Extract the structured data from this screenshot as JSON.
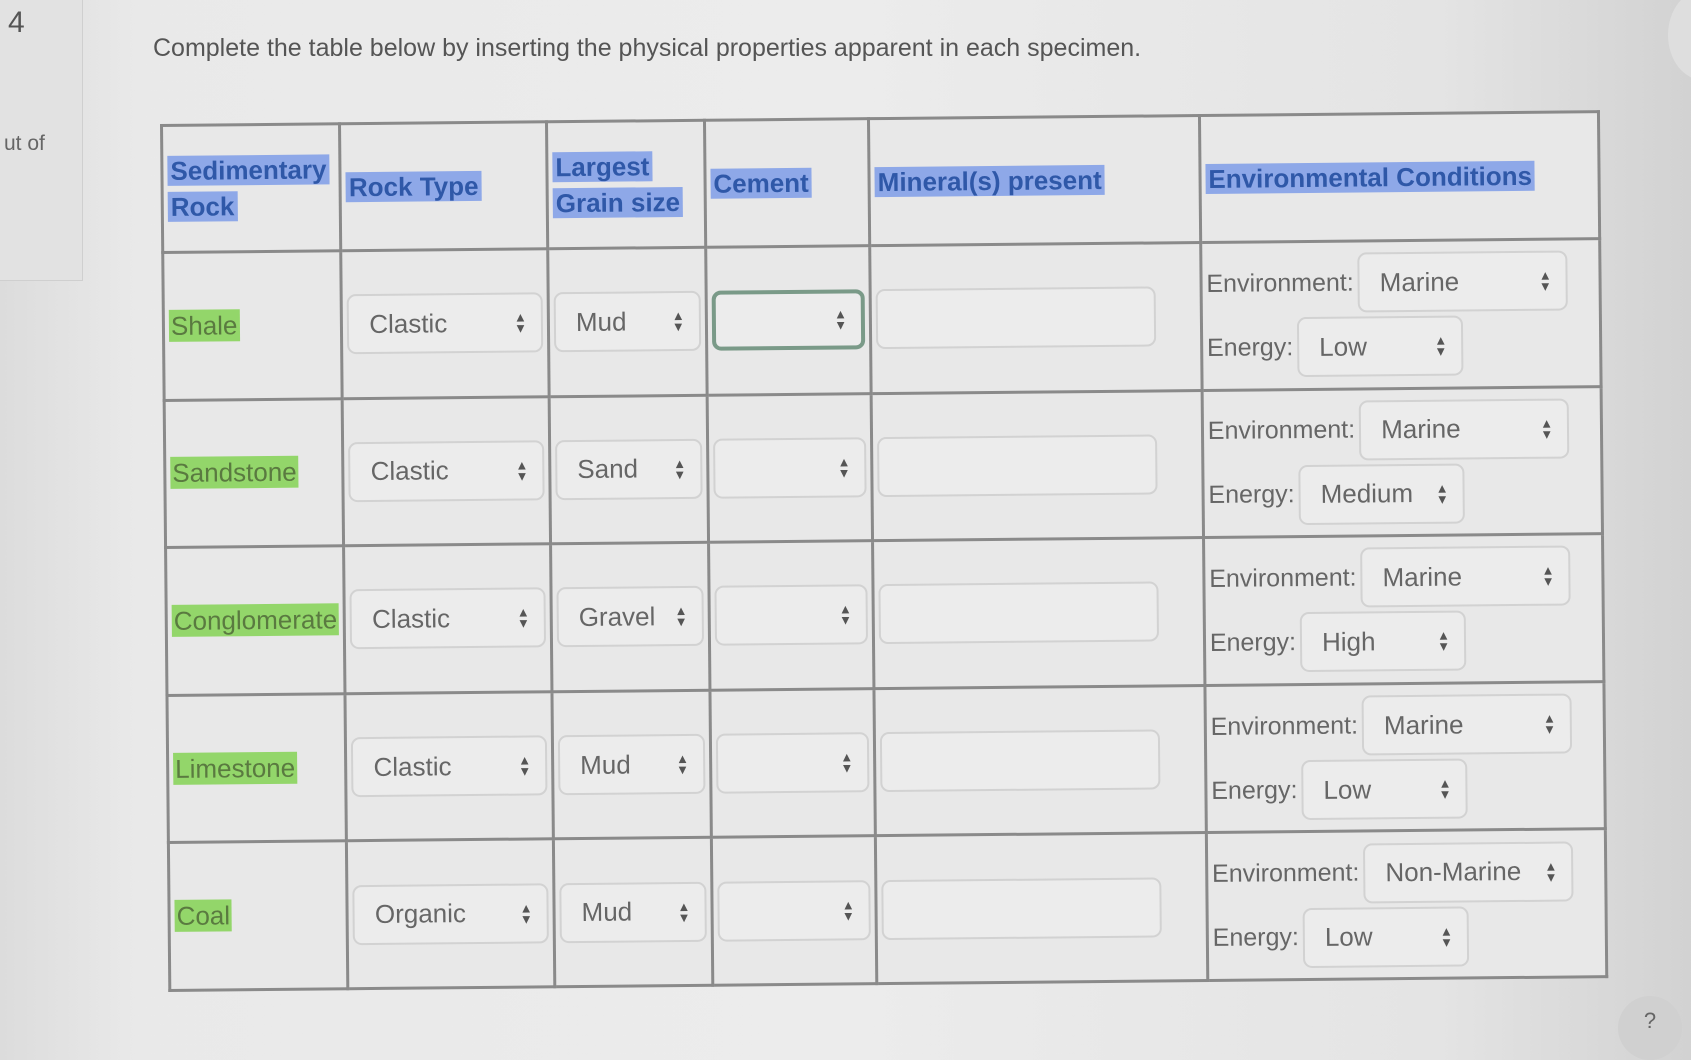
{
  "question": {
    "number": "4",
    "out_of": "ut of",
    "instruction": "Complete the table below by inserting the physical properties apparent in each specimen."
  },
  "table": {
    "headers": {
      "rock": [
        "Sedimentary",
        "Rock"
      ],
      "rock_type": "Rock Type",
      "grain_size": [
        "Largest",
        "Grain size"
      ],
      "cement": "Cement",
      "minerals": "Mineral(s) present",
      "environment": "Environmental Conditions"
    },
    "env_label": "Environment:",
    "energy_label": "Energy:",
    "rows": [
      {
        "rock": "Shale",
        "type": "Clastic",
        "grain": "Mud",
        "cement": "",
        "minerals": "",
        "environment": "Marine",
        "energy": "Low"
      },
      {
        "rock": "Sandstone",
        "type": "Clastic",
        "grain": "Sand",
        "cement": "",
        "minerals": "",
        "environment": "Marine",
        "energy": "Medium"
      },
      {
        "rock": "Conglomerate",
        "type": "Clastic",
        "grain": "Gravel",
        "cement": "",
        "minerals": "",
        "environment": "Marine",
        "energy": "High"
      },
      {
        "rock": "Limestone",
        "type": "Clastic",
        "grain": "Mud",
        "cement": "",
        "minerals": "",
        "environment": "Marine",
        "energy": "Low"
      },
      {
        "rock": "Coal",
        "type": "Organic",
        "grain": "Mud",
        "cement": "",
        "minerals": "",
        "environment": "Non-Marine",
        "energy": "Low"
      }
    ]
  },
  "help": {
    "label": "?"
  },
  "colors": {
    "header_highlight": "#8ea8e8",
    "rock_highlight": "#93d66a",
    "focus_border": "#7a9a88"
  }
}
